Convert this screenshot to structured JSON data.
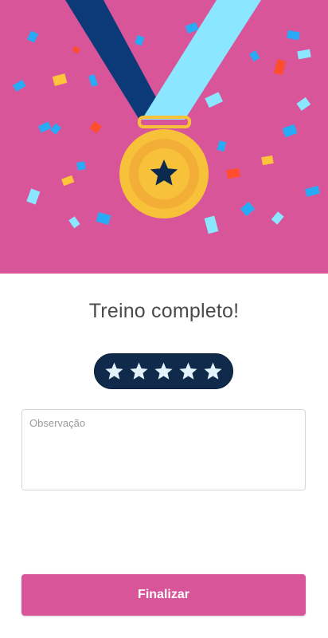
{
  "hero": {
    "illustration": "medal-with-confetti",
    "background_color": "#d9559a",
    "medal_icon": "star-medal-icon"
  },
  "main": {
    "title": "Treino completo!",
    "rating": {
      "value": 5,
      "max": 5,
      "star_icon": "star-icon"
    },
    "observation": {
      "placeholder": "Observação",
      "value": ""
    },
    "finish_button": {
      "label": "Finalizar"
    }
  },
  "colors": {
    "accent": "#d9559a",
    "rating_background": "#0f2a4a",
    "star_fill": "#e3f3fb",
    "medal_gold": "#f7c23a",
    "ribbon_dark": "#0c3a78",
    "ribbon_light": "#8be6ff"
  }
}
